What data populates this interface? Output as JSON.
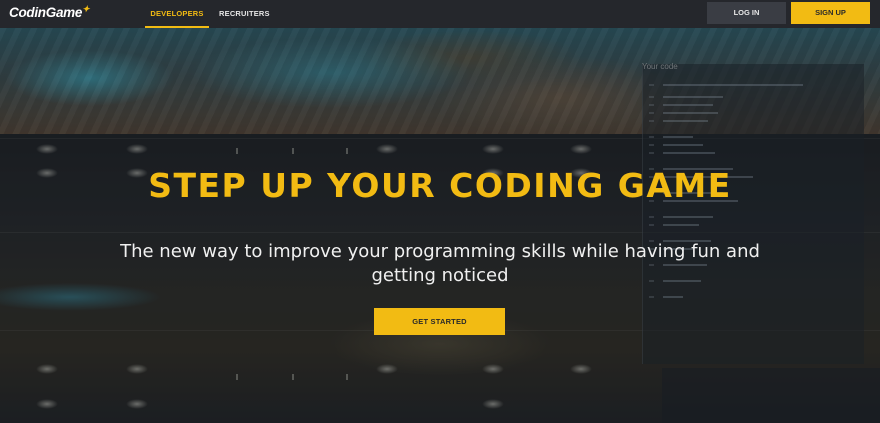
{
  "nav": {
    "logo_text": "CodinGame",
    "links": [
      {
        "label": "DEVELOPERS",
        "active": true
      },
      {
        "label": "RECRUITERS",
        "active": false
      }
    ],
    "login_label": "LOG IN",
    "signup_label": "SIGN UP"
  },
  "hero": {
    "headline": "STEP UP YOUR CODING GAME",
    "subheadline": "The new way to improve your programming skills while having fun and getting noticed",
    "cta_label": "GET STARTED",
    "background_caption": "Your code"
  },
  "colors": {
    "accent": "#f2bb13",
    "nav_bg": "#25272c",
    "login_bg": "#3a3d44"
  }
}
